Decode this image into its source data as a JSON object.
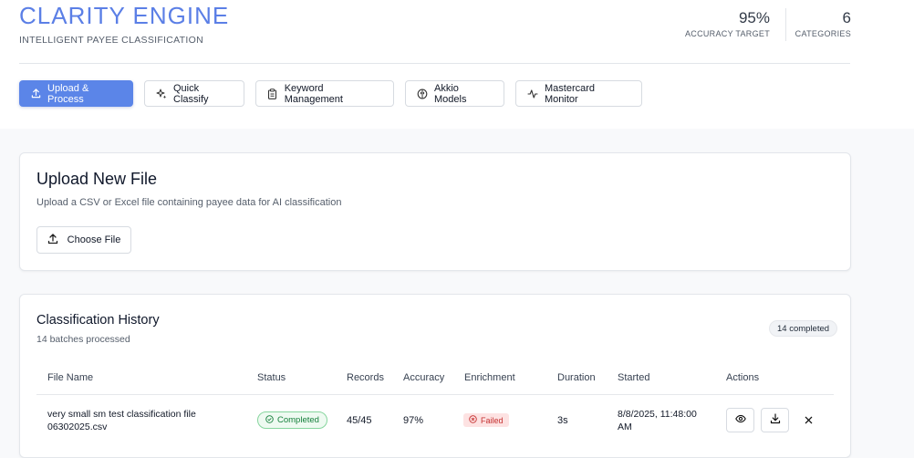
{
  "header": {
    "title": "CLARITY ENGINE",
    "subtitle": "INTELLIGENT PAYEE CLASSIFICATION",
    "stats": [
      {
        "value": "95%",
        "label": "ACCURACY TARGET"
      },
      {
        "value": "6",
        "label": "CATEGORIES"
      }
    ]
  },
  "nav": [
    {
      "label": "Upload & Process",
      "icon": "upload-icon"
    },
    {
      "label": "Quick Classify",
      "icon": "sparkles-icon"
    },
    {
      "label": "Keyword Management",
      "icon": "clipboard-icon"
    },
    {
      "label": "Akkio Models",
      "icon": "brain-icon"
    },
    {
      "label": "Mastercard Monitor",
      "icon": "activity-icon"
    }
  ],
  "upload": {
    "title": "Upload New File",
    "description": "Upload a CSV or Excel file containing payee data for AI classification",
    "button_label": "Choose File"
  },
  "history": {
    "title": "Classification History",
    "subtitle": "14 batches processed",
    "badge": "14 completed",
    "columns": [
      "File Name",
      "Status",
      "Records",
      "Accuracy",
      "Enrichment",
      "Duration",
      "Started",
      "Actions"
    ],
    "rows": [
      {
        "file_name_line1": "very small sm test classification file",
        "file_name_line2": "06302025.csv",
        "status": "Completed",
        "records": "45/45",
        "accuracy": "97%",
        "enrichment": "Failed",
        "duration": "3s",
        "started_line1": "8/8/2025, 11:48:00",
        "started_line2": "AM"
      }
    ]
  },
  "colors": {
    "brand": "#5b7fe6",
    "primary_button": "#5b85e8",
    "success": "#16803c",
    "danger": "#c53030"
  }
}
